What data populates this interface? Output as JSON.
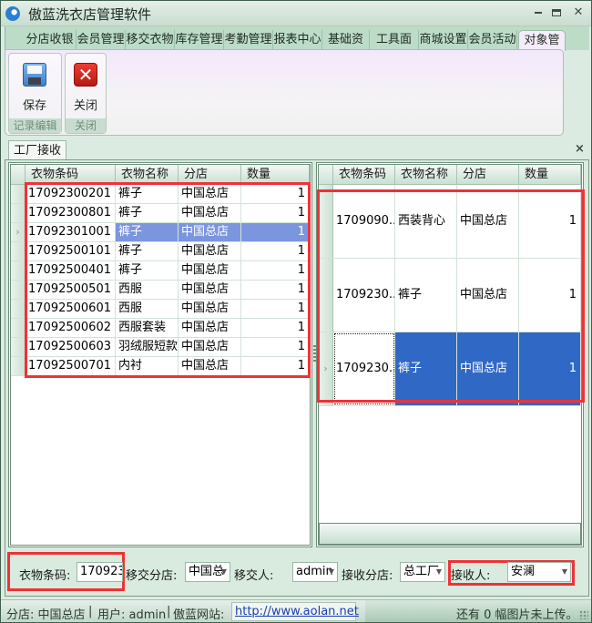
{
  "window": {
    "title": "傲蓝洗衣店管理软件",
    "icon": "app-logo-icon",
    "controls": [
      "minimize-icon",
      "maximize-icon",
      "close-icon"
    ]
  },
  "menu_tabs": [
    {
      "label": "分店收银",
      "active": false
    },
    {
      "label": "会员管理",
      "active": false
    },
    {
      "label": "移交衣物",
      "active": false
    },
    {
      "label": "库存管理",
      "active": false
    },
    {
      "label": "考勤管理",
      "active": false
    },
    {
      "label": "报表中心",
      "active": false
    },
    {
      "label": "基础资",
      "active": false
    },
    {
      "label": "工具面",
      "active": false
    },
    {
      "label": "商城设置",
      "active": false
    },
    {
      "label": "会员活动",
      "active": false
    },
    {
      "label": "对象管理",
      "active": true
    }
  ],
  "ribbon": {
    "groups": [
      {
        "caption": "记录编辑",
        "button": {
          "label": "保存",
          "icon": "floppy-disk-icon"
        }
      },
      {
        "caption": "关闭",
        "button": {
          "label": "关闭",
          "icon": "red-x-icon"
        }
      }
    ]
  },
  "document_tab": {
    "label": "工厂接收",
    "close": "×"
  },
  "left_grid": {
    "columns": [
      "衣物条码",
      "衣物名称",
      "分店",
      "数量"
    ],
    "rows": [
      {
        "code": "17092300201",
        "name": "裤子",
        "store": "中国总店",
        "qty": "1",
        "selected": false
      },
      {
        "code": "17092300801",
        "name": "裤子",
        "store": "中国总店",
        "qty": "1",
        "selected": false
      },
      {
        "code": "17092301001",
        "name": "裤子",
        "store": "中国总店",
        "qty": "1",
        "selected": true
      },
      {
        "code": "17092500101",
        "name": "裤子",
        "store": "中国总店",
        "qty": "1",
        "selected": false
      },
      {
        "code": "17092500401",
        "name": "裤子",
        "store": "中国总店",
        "qty": "1",
        "selected": false
      },
      {
        "code": "17092500501",
        "name": "西服",
        "store": "中国总店",
        "qty": "1",
        "selected": false
      },
      {
        "code": "17092500601",
        "name": "西服",
        "store": "中国总店",
        "qty": "1",
        "selected": false
      },
      {
        "code": "17092500602",
        "name": "西服套装",
        "store": "中国总店",
        "qty": "1",
        "selected": false
      },
      {
        "code": "17092500603",
        "name": "羽绒服短款",
        "store": "中国总店",
        "qty": "1",
        "selected": false
      },
      {
        "code": "17092500701",
        "name": "内衬",
        "store": "中国总店",
        "qty": "1",
        "selected": false
      }
    ],
    "current_row_marker": "›"
  },
  "right_grid": {
    "columns": [
      "衣物条码",
      "衣物名称",
      "分店",
      "数量"
    ],
    "rows": [
      {
        "code": "1709090...",
        "name": "西装背心",
        "store": "中国总店",
        "qty": "1",
        "selected": false
      },
      {
        "code": "1709230...",
        "name": "裤子",
        "store": "中国总店",
        "qty": "1",
        "selected": false
      },
      {
        "code": "1709230...",
        "name": "裤子",
        "store": "中国总店",
        "qty": "1",
        "selected": true
      }
    ],
    "current_row_marker": "›"
  },
  "form": {
    "barcode_label": "衣物条码:",
    "barcode_value": "170923(",
    "transfer_store_label": "移交分店:",
    "transfer_store_value": "中国总",
    "transfer_person_label": "移交人:",
    "transfer_person_value": "admin",
    "receive_store_label": "接收分店:",
    "receive_store_value": "总工厂",
    "receiver_label": "接收人:",
    "receiver_value": "安澜",
    "dropdown_arrow": "▼"
  },
  "statusbar": {
    "store": "分店: 中国总店",
    "sep1": "|",
    "user": "用户: admin",
    "sep2": "|",
    "site_label": "傲蓝网站:",
    "site_url": "http://www.aolan.net",
    "upload_status": "还有 0 幅图片未上传。"
  },
  "colors": {
    "accent_green": "#bcdcc8",
    "selection_light": "#7b95df",
    "selection_dark": "#3068c6",
    "annotation_red": "#ef3237",
    "link_blue": "#1a3fb0"
  }
}
